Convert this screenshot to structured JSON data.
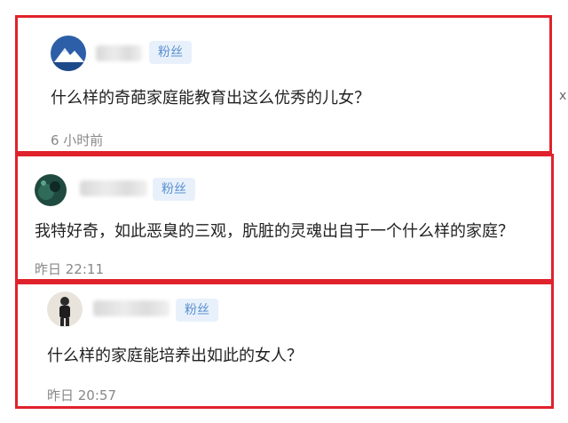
{
  "comments": [
    {
      "badge": "粉丝",
      "text": "什么样的奇葩家庭能教育出这么优秀的儿女？",
      "time": "6 小时前",
      "avatar_icon": "mountain-avatar-icon"
    },
    {
      "badge": "粉丝",
      "text": "我特好奇，如此恶臭的三观，肮脏的灵魂出自于一个什么样的家庭？",
      "time": "昨日 22:11",
      "avatar_icon": "dark-green-avatar-icon"
    },
    {
      "badge": "粉丝",
      "text": "什么样的家庭能培养出如此的女人？",
      "time": "昨日 20:57",
      "avatar_icon": "person-photo-avatar-icon"
    }
  ],
  "edge_glyph": "x",
  "colors": {
    "highlight_border": "#e0222c",
    "badge_bg": "#e8f1fb",
    "badge_text": "#5a8fd0",
    "time_text": "#888888"
  }
}
